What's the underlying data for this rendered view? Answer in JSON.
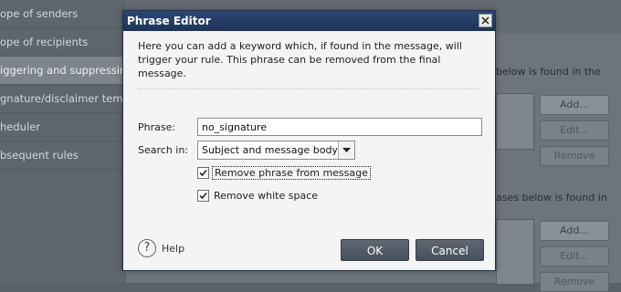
{
  "background": {
    "sidebar": {
      "items": [
        {
          "label": "ope of senders"
        },
        {
          "label": "ope of recipients"
        },
        {
          "label": "iggering and suppressing"
        },
        {
          "label": "gnature/disclaimer templat"
        },
        {
          "label": "heduler"
        },
        {
          "label": "bsequent rules"
        }
      ]
    },
    "main": {
      "text1": "below is found in the",
      "text2": "ases below is found in",
      "buttons1": [
        "Add...",
        "Edit...",
        "Remove"
      ],
      "buttons2": [
        "Add...",
        "Edit...",
        "Remove"
      ]
    }
  },
  "dialog": {
    "title": "Phrase Editor",
    "close_label": "X",
    "description": "Here you can add a keyword which, if found in the message, will trigger your rule. This phrase can be removed from the final message.",
    "phrase_label": "Phrase:",
    "phrase_value": "no_signature",
    "search_in_label": "Search in:",
    "search_in_value": "Subject and message body",
    "checkboxes": [
      {
        "label": "Remove phrase from message",
        "checked": true
      },
      {
        "label": "Remove white space",
        "checked": true
      }
    ],
    "help_icon_glyph": "?",
    "help_label": "Help",
    "ok_label": "OK",
    "cancel_label": "Cancel"
  },
  "icons": {
    "help": "help-circle-icon",
    "close": "close-icon",
    "dropdown": "chevron-down-icon",
    "check": "checkmark-icon"
  },
  "colors": {
    "titlebar": "#2c4672",
    "dialog_bg": "#f4f4f4",
    "button_bg": "#505a65"
  }
}
